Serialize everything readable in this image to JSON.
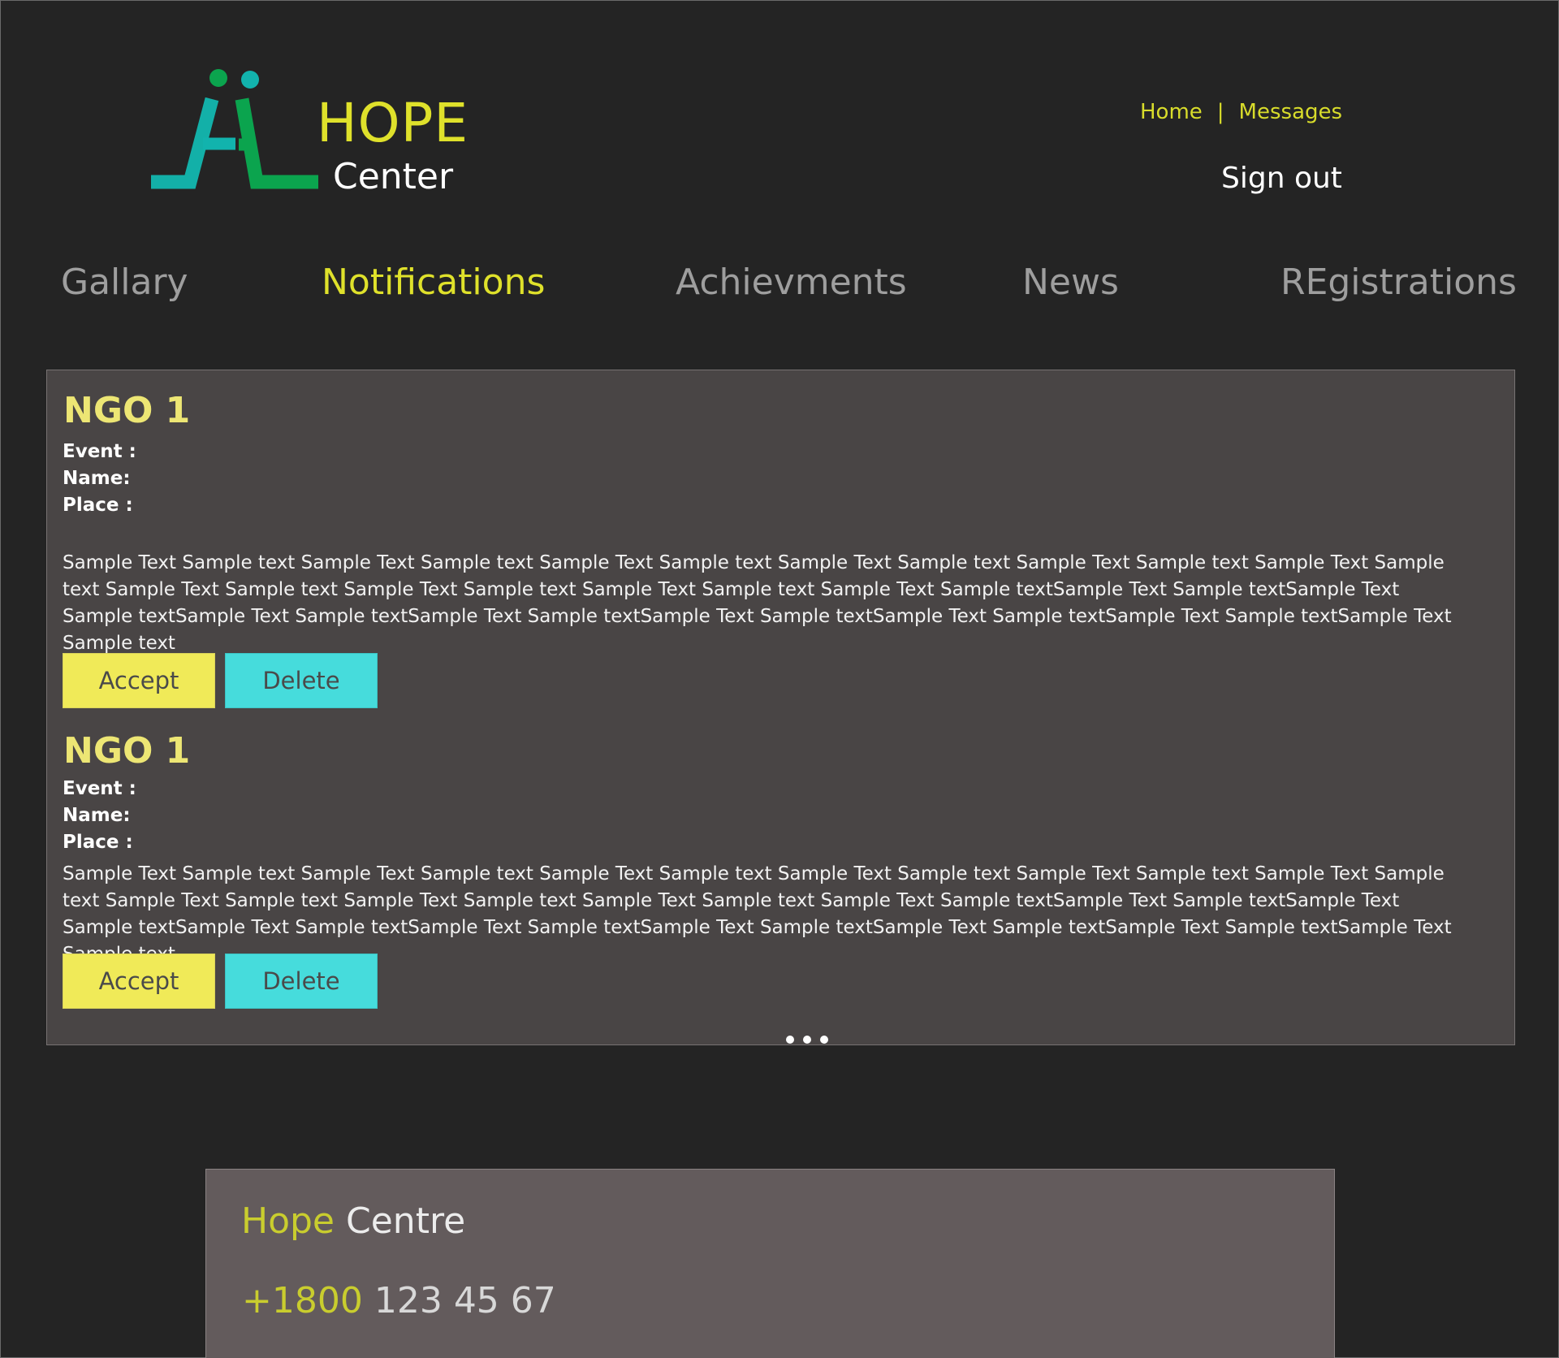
{
  "header": {
    "brand_title": "HOPE",
    "brand_subtitle": "Center",
    "links": [
      "Home",
      "Messages"
    ],
    "link_separator": "|",
    "sign_out": "Sign out"
  },
  "nav": {
    "items": [
      "Gallary",
      "Notifications",
      "Achievments",
      "News",
      "REgistrations"
    ],
    "active": "Notifications"
  },
  "notifications": [
    {
      "title": "NGO 1",
      "fields": [
        "Event :",
        "Name:",
        "Place :"
      ],
      "body": "Sample Text Sample text Sample Text Sample text Sample Text Sample text Sample Text Sample text Sample Text Sample text Sample Text Sample text Sample Text Sample text Sample Text Sample text Sample Text Sample text Sample Text Sample textSample Text Sample textSample Text Sample textSample Text Sample textSample Text Sample textSample Text Sample textSample Text Sample textSample Text Sample textSample Text Sample text",
      "accept_label": "Accept",
      "delete_label": "Delete"
    },
    {
      "title": "NGO 1",
      "fields": [
        "Event :",
        "Name:",
        "Place :"
      ],
      "body": "Sample Text Sample text Sample Text Sample text Sample Text Sample text Sample Text Sample text Sample Text Sample text Sample Text Sample text Sample Text Sample text Sample Text Sample text Sample Text Sample text Sample Text Sample textSample Text Sample textSample Text Sample textSample Text Sample textSample Text Sample textSample Text Sample textSample Text Sample textSample Text Sample textSample Text Sample text",
      "accept_label": "Accept",
      "delete_label": "Delete"
    }
  ],
  "pagination_icon": "more-dots-icon",
  "footer": {
    "brand_first": "Hope",
    "brand_second": "Centre",
    "phone_prefix": "+1800",
    "phone_number": "123 45 67"
  },
  "colors": {
    "background": "#242424",
    "accent_yellow": "#dfe12b",
    "panel": "#494545",
    "accept": "#f0ea58",
    "delete": "#46dcdc",
    "footer": "#635b5c"
  }
}
